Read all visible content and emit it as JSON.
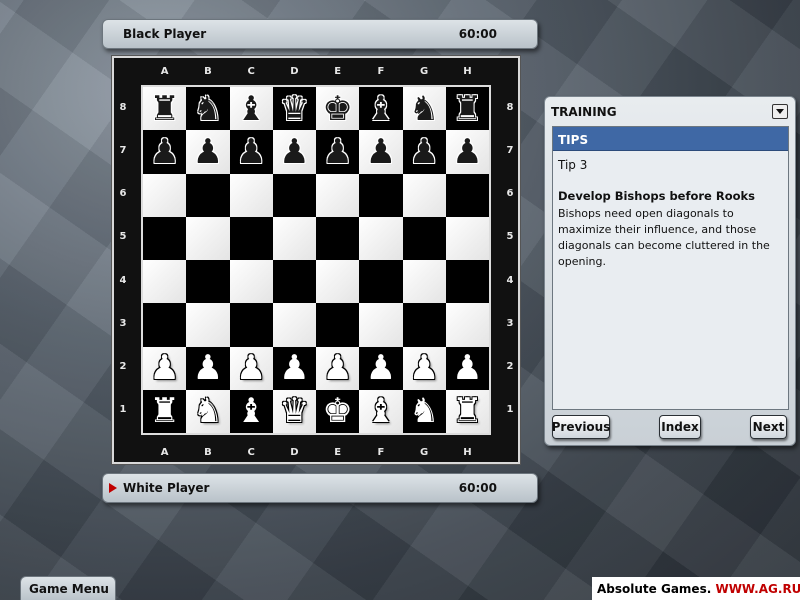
{
  "players": {
    "black": {
      "name": "Black Player",
      "time": "60:00"
    },
    "white": {
      "name": "White Player",
      "time": "60:00",
      "to_move": true
    }
  },
  "board": {
    "files": [
      "A",
      "B",
      "C",
      "D",
      "E",
      "F",
      "G",
      "H"
    ],
    "ranks": [
      "8",
      "7",
      "6",
      "5",
      "4",
      "3",
      "2",
      "1"
    ],
    "position": [
      [
        "bR",
        "bN",
        "bB",
        "bQ",
        "bK",
        "bB",
        "bN",
        "bR"
      ],
      [
        "bP",
        "bP",
        "bP",
        "bP",
        "bP",
        "bP",
        "bP",
        "bP"
      ],
      [
        "",
        "",
        "",
        "",
        "",
        "",
        "",
        ""
      ],
      [
        "",
        "",
        "",
        "",
        "",
        "",
        "",
        ""
      ],
      [
        "",
        "",
        "",
        "",
        "",
        "",
        "",
        ""
      ],
      [
        "",
        "",
        "",
        "",
        "",
        "",
        "",
        ""
      ],
      [
        "wP",
        "wP",
        "wP",
        "wP",
        "wP",
        "wP",
        "wP",
        "wP"
      ],
      [
        "wR",
        "wN",
        "wB",
        "wQ",
        "wK",
        "wB",
        "wN",
        "wR"
      ]
    ],
    "glyphs": {
      "K": "♚",
      "Q": "♛",
      "R": "♜",
      "B": "♝",
      "N": "♞",
      "P": "♟"
    }
  },
  "training": {
    "title": "TRAINING",
    "section": "TIPS",
    "tip_number": "Tip 3",
    "tip_heading": "Develop Bishops before Rooks",
    "tip_body": "Bishops need open diagonals to maximize their influence, and those diagonals can become cluttered in the opening.",
    "buttons": {
      "previous": "Previous",
      "index": "Index",
      "next": "Next"
    }
  },
  "game_menu_label": "Game Menu",
  "watermark": {
    "brand": "Absolute Games. ",
    "url": "WWW.AG.RU"
  },
  "colors": {
    "accent": "#3f68a5",
    "turn_indicator": "#c00000"
  }
}
